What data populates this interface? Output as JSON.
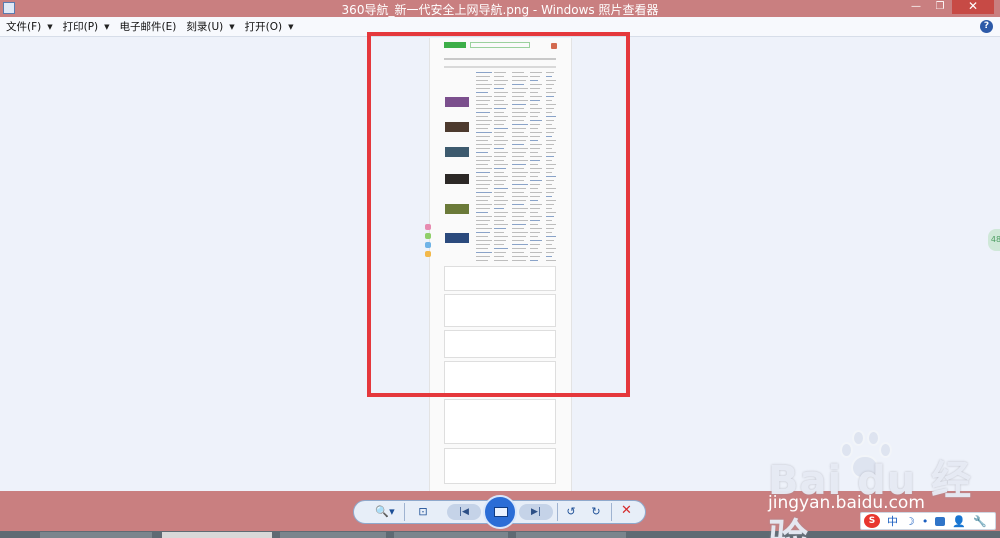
{
  "window": {
    "title": "360导航_新一代安全上网导航.png - Windows 照片查看器",
    "controls": {
      "minimize": "—",
      "maximize": "❐",
      "close": "✕"
    }
  },
  "menu": {
    "items": [
      {
        "label": "文件(F)"
      },
      {
        "label": "打印(P)"
      },
      {
        "label": "电子邮件(E)"
      },
      {
        "label": "刻录(U)"
      },
      {
        "label": "打开(O)"
      }
    ],
    "help": "?"
  },
  "viewer": {
    "side_tab": "48"
  },
  "toolbar": {
    "zoom": "🔍▾",
    "actual_size": "⊡",
    "previous": "|◀",
    "next": "▶|",
    "rotate_left": "↺",
    "rotate_right": "↻",
    "delete": "✕"
  },
  "watermark": {
    "brand": "Bai du 经验",
    "url": "jingyan.baidu.com"
  },
  "ime": {
    "logo": "S",
    "lang": "中",
    "moon": "☽",
    "dot": "•",
    "user": "👤",
    "tools": "🔧"
  },
  "colors": {
    "chrome": "#c97f80",
    "highlight": "#e5383c",
    "background": "#eef2fa"
  }
}
